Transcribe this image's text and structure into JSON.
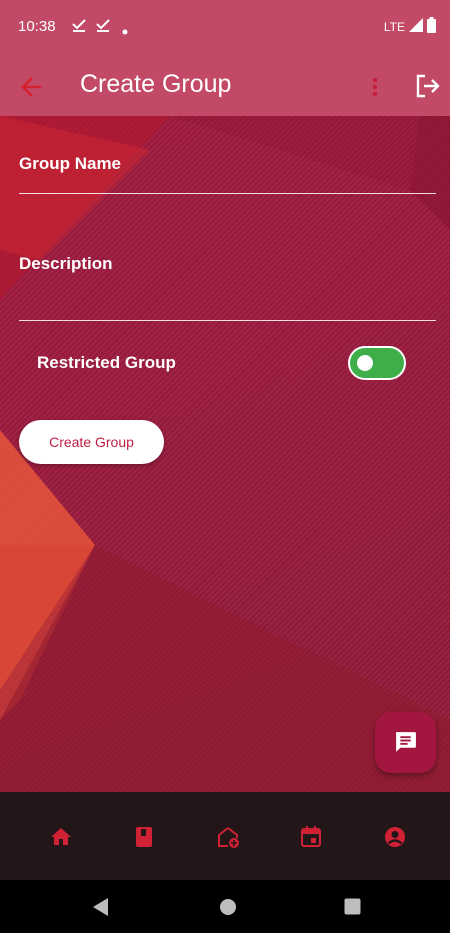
{
  "status_bar": {
    "time": "10:38",
    "network": "LTE"
  },
  "app_bar": {
    "title": "Create Group"
  },
  "form": {
    "group_name": {
      "label": "Group Name",
      "value": ""
    },
    "description": {
      "label": "Description",
      "value": ""
    },
    "restricted": {
      "label": "Restricted Group",
      "enabled": true
    },
    "submit_label": "Create Group"
  },
  "bottom_nav": {
    "items": [
      {
        "icon": "home-icon"
      },
      {
        "icon": "book-icon"
      },
      {
        "icon": "add-home-icon"
      },
      {
        "icon": "calendar-icon"
      },
      {
        "icon": "account-icon"
      }
    ]
  },
  "colors": {
    "accent": "#c21e44",
    "app_bar": "#c24a67",
    "toggle_on": "#3fae4a",
    "fab": "#a3163f",
    "bottom_nav": "#231619"
  }
}
